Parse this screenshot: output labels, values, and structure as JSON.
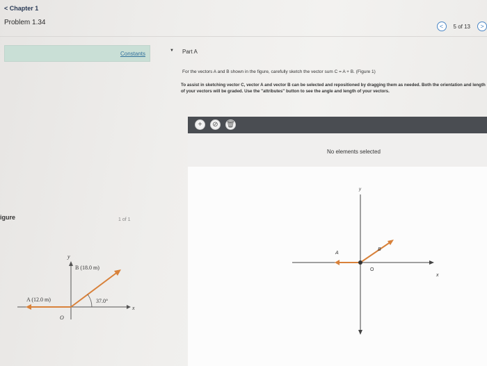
{
  "header": {
    "back_label": "< Chapter 1",
    "problem_title": "Problem 1.34",
    "page_count": "5 of 13",
    "prev_icon": "chevron-left-icon",
    "next_icon": "chevron-right-icon"
  },
  "left_panel": {
    "constants_label": "Constants",
    "figure_label": "igure",
    "figure_count": "1 of 1",
    "figure": {
      "vector_a_label": "A (12.0 m)",
      "vector_b_label": "B (18.0 m)",
      "angle_label": "37.0°",
      "x_axis_label": "x",
      "y_axis_label": "y",
      "origin_label": "O"
    }
  },
  "part": {
    "toggle_icon": "caret-down-icon",
    "title": "Part A",
    "instruction_1": "For the vectors A and B shown in the figure, carefully sketch the vector sum C = A + B. (Figure 1)",
    "instruction_2": "To assist in sketching vector C, vector A and vector B can be selected and repositioned by dragging them as needed. Both the orientation and length of your vectors will be graded. Use the \"attributes\" button to see the angle and length of your vectors."
  },
  "canvas": {
    "toolbar_icons": [
      "plus-icon",
      "clear-icon",
      "trash-icon"
    ],
    "status_text": "No elements selected",
    "graph": {
      "x_axis_label": "x",
      "y_axis_label": "y",
      "origin_label": "O",
      "vector_a_label": "A",
      "vector_b_label": "B"
    }
  },
  "colors": {
    "constants_bg": "#c9dfd6",
    "link": "#2f6f9a",
    "toolbar_bg": "#4a4d52",
    "vector": "#d8813a",
    "accent": "#4a86c5"
  }
}
